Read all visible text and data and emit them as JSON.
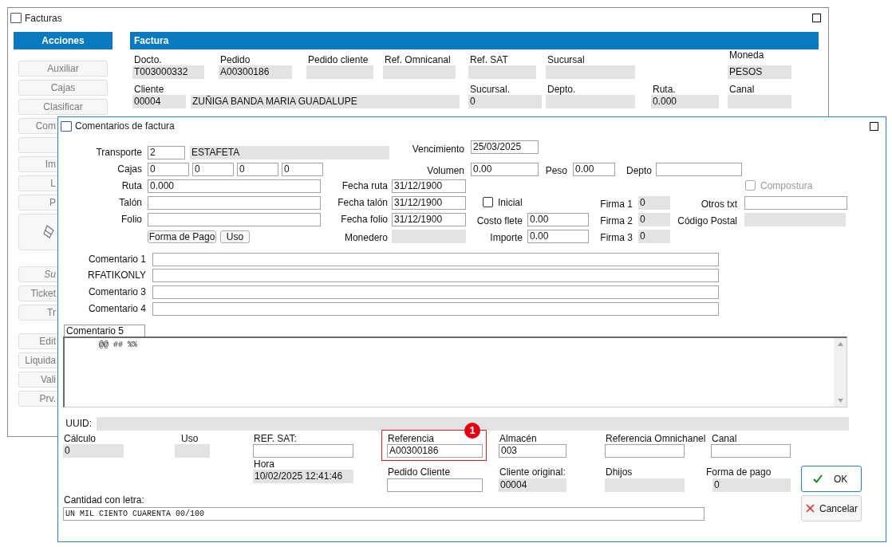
{
  "main_window": {
    "title": "Facturas"
  },
  "actions": {
    "title": "Acciones",
    "groups": [
      {
        "buttons": [
          {
            "kind": "full",
            "label": "Auxiliar",
            "italic": false
          },
          {
            "kind": "full",
            "label": "Cajas",
            "italic": false
          },
          {
            "kind": "full",
            "label": "Clasificar",
            "italic": false
          },
          {
            "kind": "cut",
            "label": "Com",
            "italic": false
          },
          {
            "kind": "cut"
          },
          {
            "kind": "cut",
            "label": "Im",
            "italic": false
          },
          {
            "kind": "cut",
            "label": "L",
            "italic": false
          },
          {
            "kind": "cut",
            "label": "P",
            "italic": false
          },
          {
            "kind": "icon"
          }
        ]
      },
      {
        "buttons": [
          {
            "kind": "cut",
            "label": "Su",
            "italic": true
          },
          {
            "kind": "cut",
            "label": "Ticket",
            "italic": false
          },
          {
            "kind": "cut",
            "label": "Tr",
            "italic": false
          }
        ]
      },
      {
        "buttons": [
          {
            "kind": "cut",
            "label": "Edit",
            "italic": false
          },
          {
            "kind": "cut",
            "label": "Liquida",
            "italic": false
          },
          {
            "kind": "cut",
            "label": "Vali",
            "italic": false
          },
          {
            "kind": "cut",
            "label": "Prv.",
            "italic": false
          }
        ]
      }
    ]
  },
  "factura": {
    "title": "Factura",
    "fields": [
      {
        "label": "Docto.",
        "value": "T003000332"
      },
      {
        "label": "Pedido",
        "value": "A00300186"
      },
      {
        "label": "Pedido cliente"
      },
      {
        "label": "Ref. Omnicanal"
      },
      {
        "label": "Ref. SAT"
      },
      {
        "label": "Sucursal"
      },
      {
        "label": "Moneda",
        "value": "PESOS"
      },
      {
        "label": "Cliente",
        "value": "00004"
      },
      {
        "value": "ZUÑIGA BANDA MARIA GUADALUPE"
      },
      {
        "label": "Sucursal.",
        "value": "0"
      },
      {
        "label": "Depto."
      },
      {
        "label": "Ruta.",
        "value": "0.000"
      },
      {
        "label": "Canal"
      }
    ]
  },
  "dialog": {
    "title": "Comentarios de factura",
    "fields": [
      {
        "kind": "input",
        "label": "Transporte",
        "value": "2"
      },
      {
        "kind": "readonly",
        "value": "ESTAFETA"
      },
      {
        "kind": "input",
        "label": "Vencimiento",
        "value": "25/03/2025"
      },
      {
        "kind": "multi",
        "label": "Cajas",
        "values": [
          "0",
          "0",
          "0",
          "0"
        ]
      },
      {
        "kind": "input",
        "label": "Volumen",
        "value": "0.00"
      },
      {
        "kind": "input",
        "label": "Peso",
        "value": "0.00"
      },
      {
        "kind": "input",
        "label": "Depto"
      },
      {
        "kind": "input",
        "label": "Ruta",
        "value": "0.000"
      },
      {
        "kind": "input",
        "label": "Fecha ruta",
        "value": "31/12/1900"
      },
      {
        "kind": "checkbox",
        "label": "Compostura",
        "checked": false,
        "disabled": true
      },
      {
        "kind": "input",
        "label": "Talón"
      },
      {
        "kind": "input",
        "label": "Fecha talón",
        "value": "31/12/1900"
      },
      {
        "kind": "checkbox",
        "label": "Inicial",
        "checked": false,
        "disabled": false
      },
      {
        "kind": "readonly",
        "label": "Firma 1",
        "value": "0"
      },
      {
        "kind": "input",
        "label": "Otros txt"
      },
      {
        "kind": "input",
        "label": "Folio"
      },
      {
        "kind": "input",
        "label": "Fecha folio",
        "value": "31/12/1900"
      },
      {
        "kind": "input",
        "label": "Costo flete",
        "value": "0.00"
      },
      {
        "kind": "readonly",
        "label": "Firma 2",
        "value": "0"
      },
      {
        "kind": "readonly",
        "label": "Código Postal"
      },
      {
        "kind": "button",
        "label": "Forma de Pago"
      },
      {
        "kind": "button",
        "label": "Uso"
      },
      {
        "kind": "readonly",
        "label": "Monedero"
      },
      {
        "kind": "input",
        "label": "Importe",
        "value": "0.00"
      },
      {
        "kind": "readonly",
        "label": "Firma 3",
        "value": "0"
      },
      {
        "kind": "input",
        "label": "Comentario 1"
      },
      {
        "kind": "input",
        "label": "RFATIKONLY"
      },
      {
        "kind": "input",
        "label": "Comentario 3"
      },
      {
        "kind": "input",
        "label": "Comentario 4"
      },
      {
        "kind": "readonly",
        "label": "UUID:"
      },
      {
        "kind": "readonly",
        "label": "Cálculo",
        "value": "0"
      },
      {
        "kind": "readonly",
        "label": "Uso"
      },
      {
        "kind": "input",
        "label": "REF. SAT:"
      },
      {
        "kind": "input",
        "label": "Referencia",
        "value": "A00300186",
        "callout": "1"
      },
      {
        "kind": "input",
        "label": "Almacén",
        "value": "003"
      },
      {
        "kind": "input",
        "label": "Referencia Omnichanel"
      },
      {
        "kind": "input",
        "label": "Canal"
      },
      {
        "kind": "readonly",
        "label": "Hora",
        "value": "10/02/2025 12:41:46"
      },
      {
        "kind": "input",
        "label": "Pedido Cliente"
      },
      {
        "kind": "readonly",
        "label": "Cliente original:",
        "value": "00004"
      },
      {
        "kind": "readonly",
        "label": "Dhijos"
      },
      {
        "kind": "readonly",
        "label": "Forma de pago",
        "value": "0"
      },
      {
        "kind": "input",
        "label": "Cantidad con letra:",
        "value": "UN MIL CIENTO CUARENTA 00/100"
      }
    ],
    "memo": {
      "tab": "Comentario 5",
      "value": "@@ ## %%"
    },
    "buttons": [
      {
        "kind": "ok",
        "label": "OK"
      },
      {
        "kind": "cancel",
        "label": "Cancelar"
      }
    ]
  }
}
